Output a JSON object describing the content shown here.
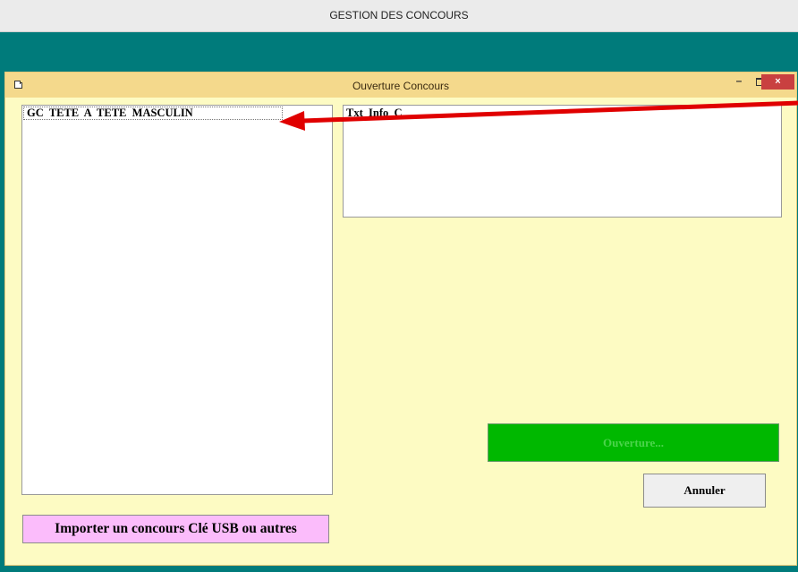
{
  "app": {
    "title": "GESTION DES CONCOURS"
  },
  "dialog": {
    "title": "Ouverture Concours",
    "window_controls": {
      "minimize": "–",
      "close": "×"
    },
    "list": {
      "items": [
        "GC  TETE  A  TETE  MASCULIN"
      ]
    },
    "info_box": {
      "label": "Txt_Info_C"
    },
    "buttons": {
      "open": "Ouverture...",
      "cancel": "Annuler",
      "import": "Importer un concours Clé USB ou autres"
    }
  },
  "colors": {
    "teal_background": "#007b7b",
    "dialog_background": "#fdfbc3",
    "dialog_titlebar": "#f4d98c",
    "open_button": "#00b800",
    "import_button": "#fbbcfb",
    "annotation_arrow": "#e00000"
  }
}
